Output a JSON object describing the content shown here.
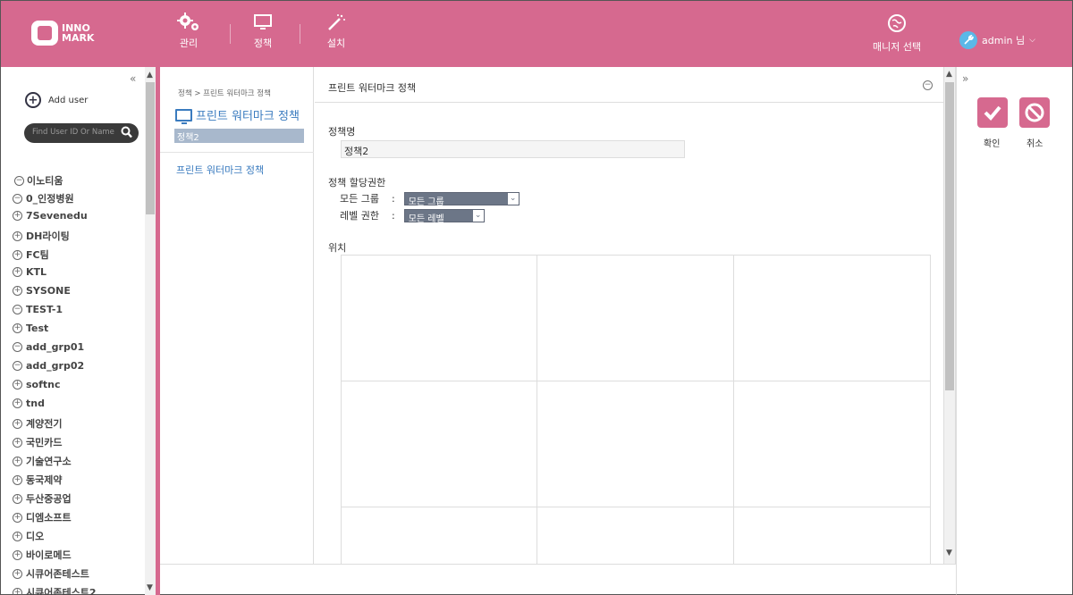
{
  "header": {
    "logo_line1": "INNO",
    "logo_line2": "MARK",
    "nav": [
      {
        "label": "관리"
      },
      {
        "label": "정책"
      },
      {
        "label": "설치"
      }
    ],
    "manager_select": "매니저 선택",
    "user_label": "admin 님"
  },
  "sidebar": {
    "add_user": "Add user",
    "search_placeholder": "Find User ID Or Name",
    "tree_root": "이노티움",
    "tree_items": [
      {
        "label": "0_인정병원",
        "state": "-"
      },
      {
        "label": "7Sevenedu",
        "state": "+"
      },
      {
        "label": "DH라이팅",
        "state": "+"
      },
      {
        "label": "FC팀",
        "state": "+"
      },
      {
        "label": "KTL",
        "state": "+"
      },
      {
        "label": "SYSONE",
        "state": "+"
      },
      {
        "label": "TEST-1",
        "state": "-"
      },
      {
        "label": "Test",
        "state": "+"
      },
      {
        "label": "add_grp01",
        "state": "-"
      },
      {
        "label": "add_grp02",
        "state": "-"
      },
      {
        "label": "softnc",
        "state": "+"
      },
      {
        "label": "tnd",
        "state": "+"
      },
      {
        "label": "계양전기",
        "state": "+"
      },
      {
        "label": "국민카드",
        "state": "+"
      },
      {
        "label": "기술연구소",
        "state": "+"
      },
      {
        "label": "동국제약",
        "state": "+"
      },
      {
        "label": "두산중공업",
        "state": "+"
      },
      {
        "label": "디엠소프트",
        "state": "+"
      },
      {
        "label": "디오",
        "state": "+"
      },
      {
        "label": "바이로메드",
        "state": "+"
      },
      {
        "label": "시큐어존테스트",
        "state": "+"
      },
      {
        "label": "시큐어존테스트2",
        "state": "+"
      }
    ]
  },
  "midnav": {
    "breadcrumb": "정책 > 프린트 워터마크 정책",
    "title": "프린트 워터마크 정책",
    "selected": "정책2",
    "link": "프린트 워터마크 정책"
  },
  "main": {
    "title": "프린트 워터마크 정책",
    "policy_name_label": "정책명",
    "policy_name_value": "정책2",
    "permission_label": "정책 할당권한",
    "group_label": "모든 그룹",
    "group_colon": ":",
    "group_value": "모든 그룹",
    "level_label": "레벨 권한",
    "level_colon": ":",
    "level_value": "모든 레벨",
    "position_label": "위치"
  },
  "actions": {
    "confirm": "확인",
    "cancel": "취소"
  },
  "colors": {
    "brand": "#d6698f",
    "link": "#3a7bbf",
    "select_bg": "#6c7687"
  }
}
